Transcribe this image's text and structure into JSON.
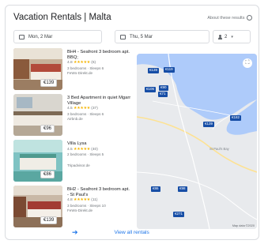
{
  "header": {
    "title": "Vacation Rentals | Malta",
    "about": "About these results"
  },
  "filters": {
    "checkin": "Mon, 2 Mar",
    "checkout": "Thu, 5 Mar",
    "guests": "2"
  },
  "listings": [
    {
      "name": "BH4 - Seafront 3 bedroom apt. BBQ;",
      "rating": "4.8",
      "stars": "★★★★★",
      "reviews": "(6)",
      "details": "3 bedrooms · Sleeps 6",
      "source": "FeWo-Direkt.de",
      "price": "€139"
    },
    {
      "name": "3 Bed Apartment in quiet Mgarr Village",
      "rating": "4.5",
      "stars": "★★★★★",
      "reviews": "(37)",
      "details": "3 bedrooms · Sleeps 6",
      "source": "Airbnb.de",
      "price": "€96"
    },
    {
      "name": "Villa Lysa",
      "rating": "4.5",
      "stars": "★★★★★",
      "reviews": "(40)",
      "details": "2 bedrooms · Sleeps 5",
      "source": "Tripadvisor.de",
      "price": "€86"
    },
    {
      "name": "BH2 - Seafront 3 bedroom apt. - St Paul's",
      "rating": "4.8",
      "stars": "★★★★★",
      "reviews": "(11)",
      "details": "3 bedrooms · Sleeps 10",
      "source": "FeWo-Direkt.de",
      "price": "€139"
    }
  ],
  "map": {
    "pins": [
      "€139",
      "€119",
      "€106",
      "€90",
      "€71",
      "€139",
      "€182",
      "€86",
      "€98",
      "€271"
    ],
    "towns": [
      "St Paul's Bay"
    ],
    "attribution": "Map data ©2020"
  },
  "footer": {
    "view_all": "View all rentals"
  },
  "colors": {
    "accent": "#1a73e8",
    "pin": "#174ea6",
    "star": "#f4b400"
  }
}
